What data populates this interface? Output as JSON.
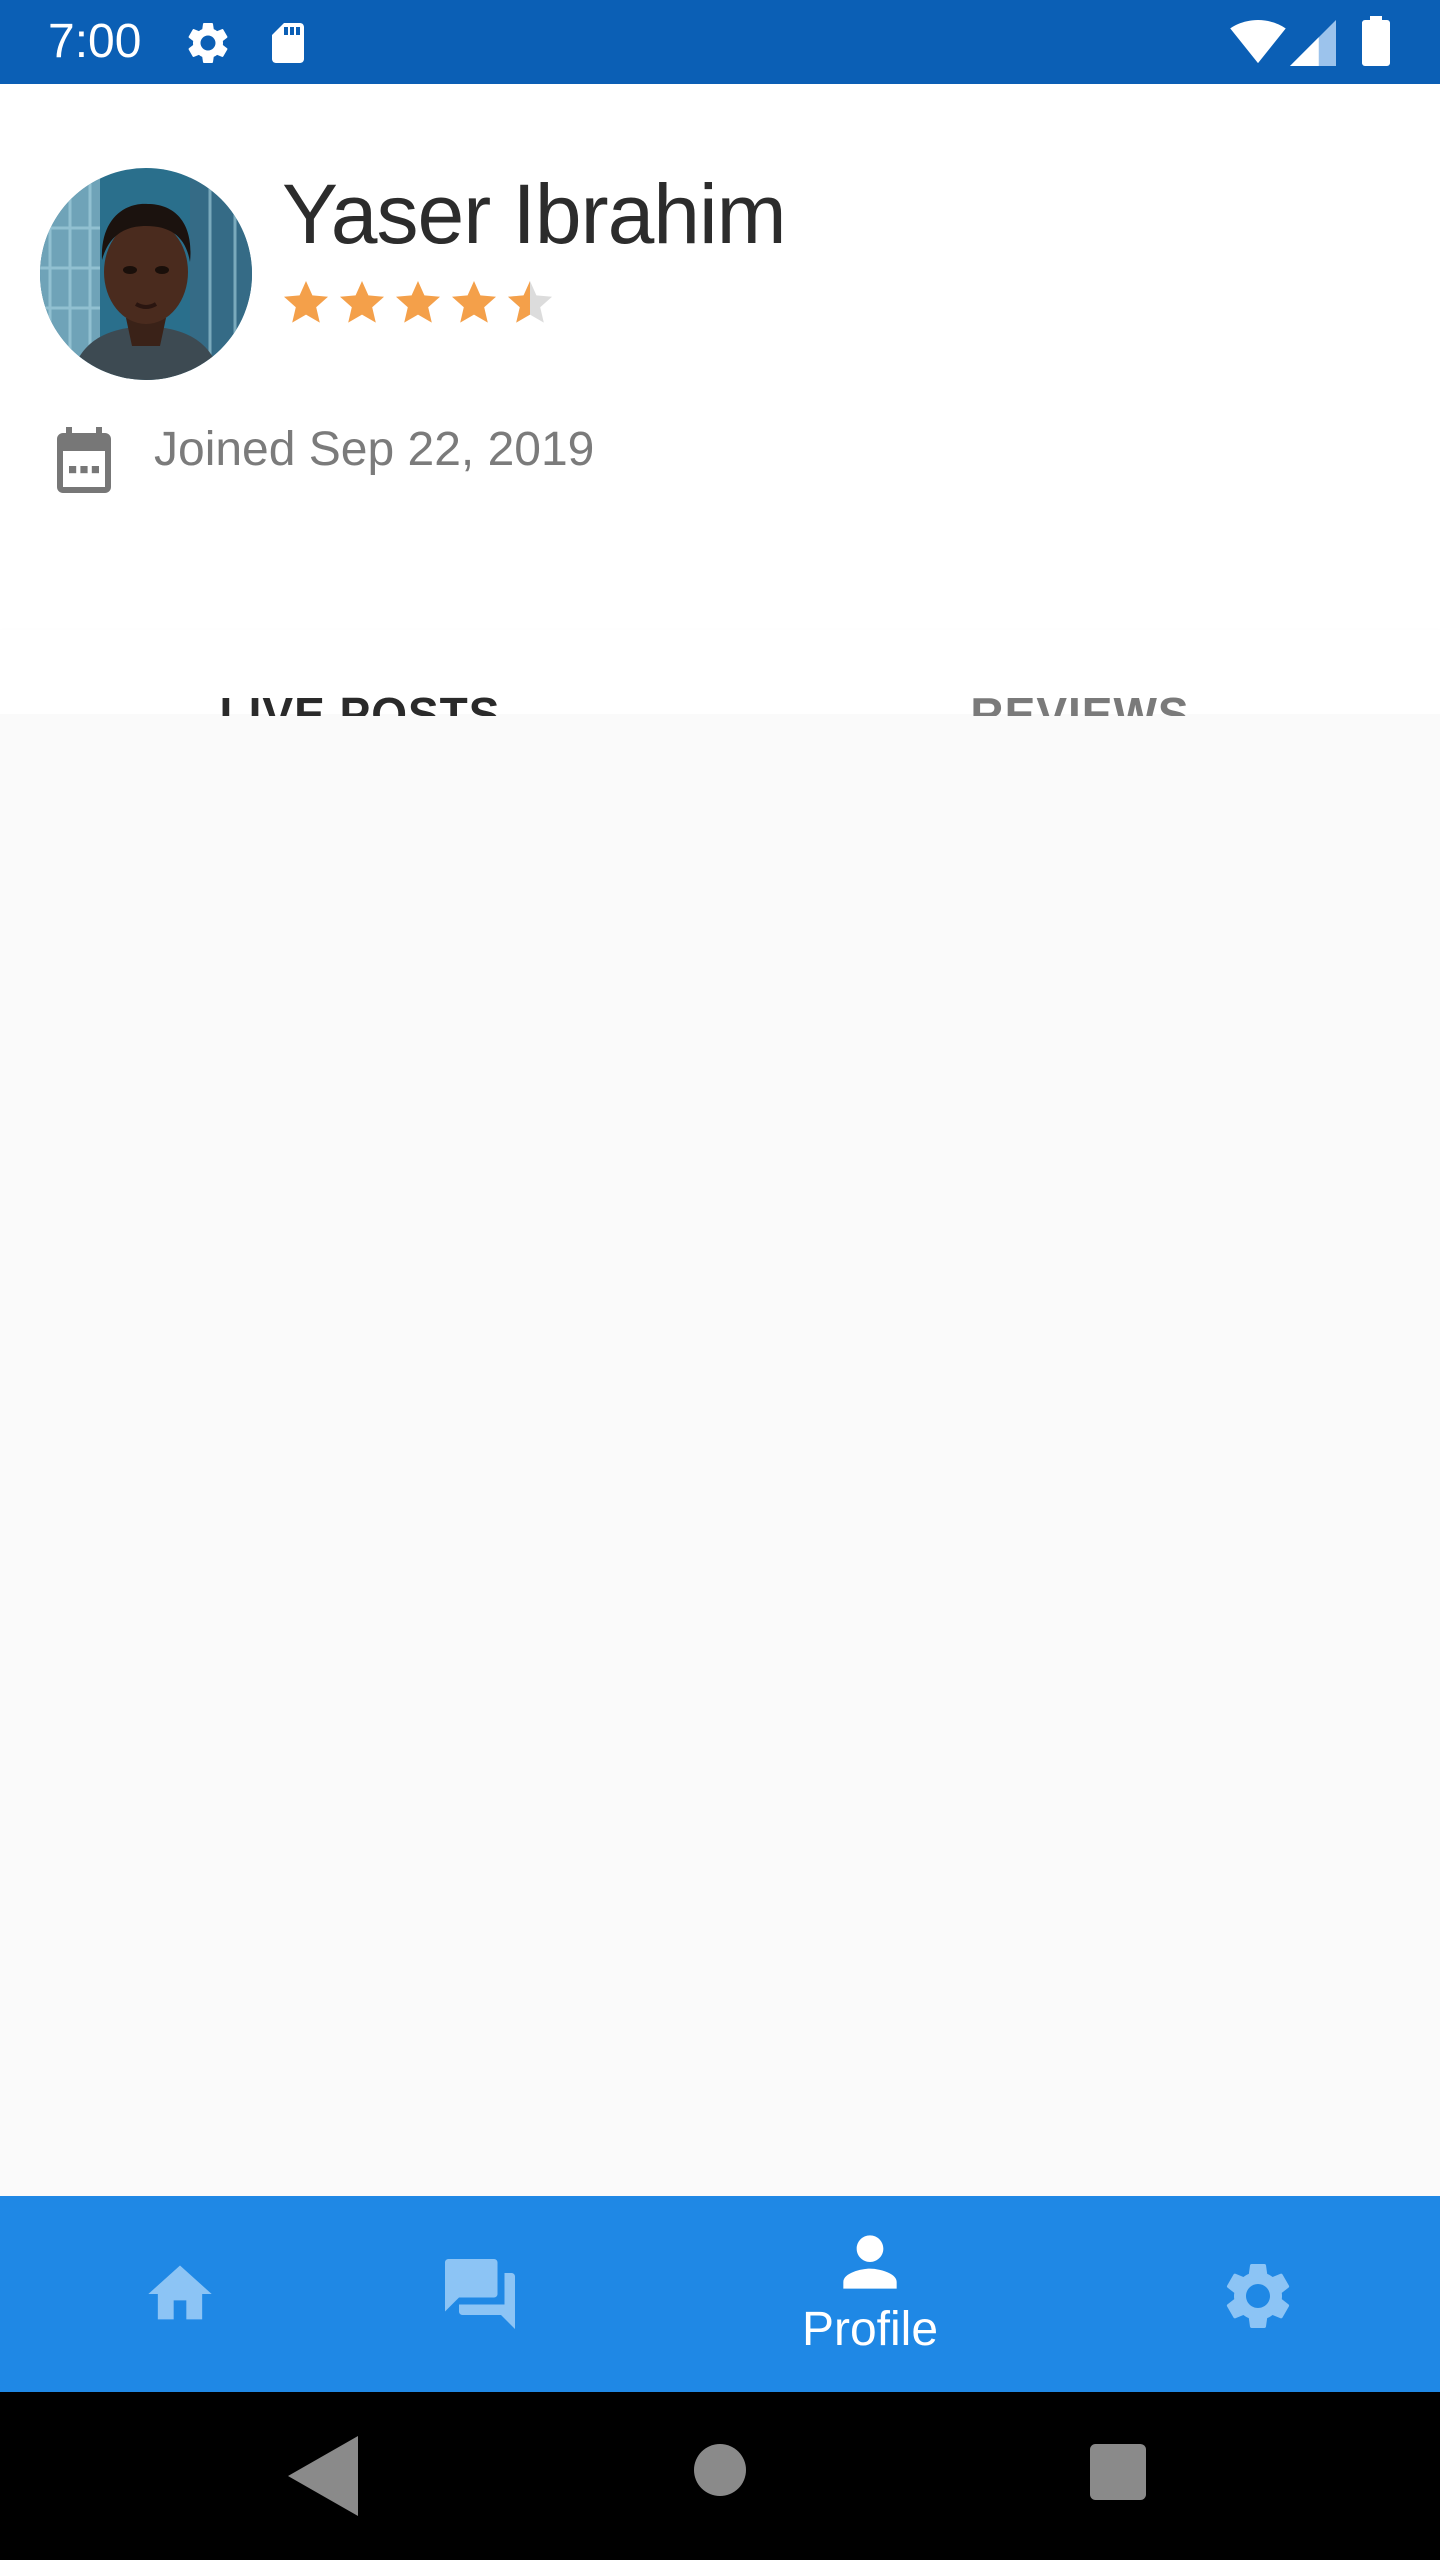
{
  "status_bar": {
    "time": "7:00",
    "icons": [
      "gear-icon",
      "sd-card-icon",
      "wifi-icon",
      "signal-icon",
      "battery-icon"
    ],
    "background": "#0b5fb5"
  },
  "profile": {
    "name": "Yaser Ibrahim",
    "rating": 4.5,
    "rating_max": 5,
    "star_color": "#f4a04a",
    "joined": "Joined Sep 22, 2019"
  },
  "tabs": [
    {
      "label": "LIVE POSTS",
      "active": true
    },
    {
      "label": "REVIEWS",
      "active": false
    }
  ],
  "tab_indicator_color": "#4a9ff5",
  "bottom_nav": {
    "background": "#1f88e5",
    "items": [
      {
        "icon": "home-icon",
        "label": "",
        "active": false
      },
      {
        "icon": "chat-icon",
        "label": "",
        "active": false
      },
      {
        "icon": "person-icon",
        "label": "Profile",
        "active": true
      },
      {
        "icon": "settings-icon",
        "label": "",
        "active": false
      }
    ]
  },
  "system_nav": {
    "icons": [
      "back-icon",
      "home-circle-icon",
      "recents-icon"
    ]
  }
}
